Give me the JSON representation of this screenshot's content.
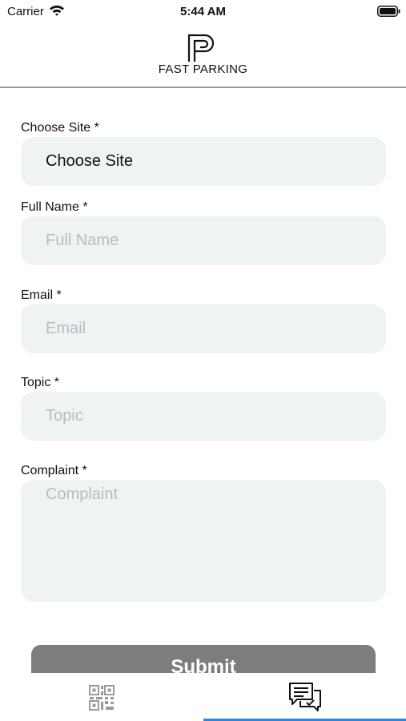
{
  "status_bar": {
    "carrier": "Carrier",
    "time": "5:44 AM",
    "wifi_icon": "wifi-icon",
    "battery_icon": "battery-icon"
  },
  "header": {
    "logo_icon": "fast-parking-logo",
    "logo_text": "FAST PARKING"
  },
  "form": {
    "site": {
      "label": "Choose Site *",
      "value": "Choose Site"
    },
    "full_name": {
      "label": "Full Name *",
      "placeholder": "Full Name"
    },
    "email": {
      "label": "Email *",
      "placeholder": "Email"
    },
    "topic": {
      "label": "Topic *",
      "placeholder": "Topic"
    },
    "complaint": {
      "label": "Complaint *",
      "placeholder": "Complaint"
    },
    "submit_label": "Submit"
  },
  "tab_bar": {
    "tabs": [
      {
        "icon": "qr-code-icon",
        "selected": false
      },
      {
        "icon": "chat-bubbles-icon",
        "selected": true
      }
    ],
    "indicator_color": "#2f86e0"
  },
  "colors": {
    "field_background": "#f0f3f4",
    "placeholder": "#b6bcc0",
    "submit_background": "#7d7d7d"
  }
}
